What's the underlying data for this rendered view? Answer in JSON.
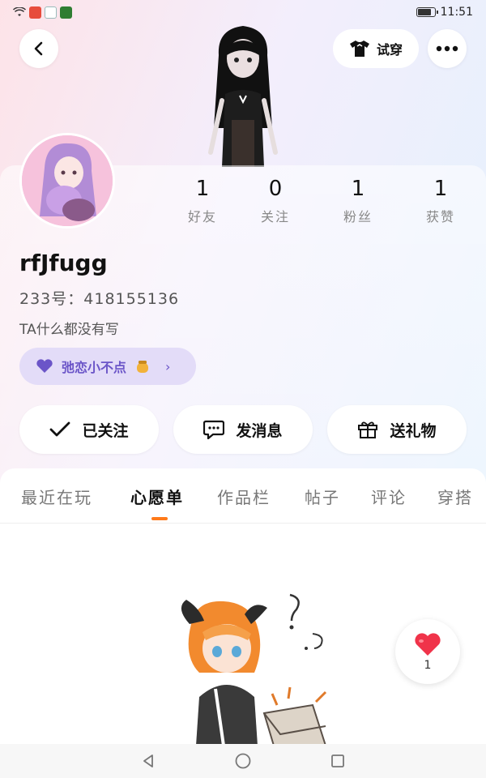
{
  "status_bar": {
    "time": "11:51"
  },
  "header": {
    "try_on_label": "试穿"
  },
  "stats": [
    {
      "value": "1",
      "label": "好友"
    },
    {
      "value": "0",
      "label": "关注"
    },
    {
      "value": "1",
      "label": "粉丝"
    },
    {
      "value": "1",
      "label": "获赞"
    }
  ],
  "profile": {
    "username": "rfJfugg",
    "uid": "233号：418155136",
    "bio": "TA什么都没有写",
    "fan_badge": "弛恋小不点"
  },
  "actions": {
    "follow_label": "已关注",
    "message_label": "发消息",
    "gift_label": "送礼物"
  },
  "tabs": [
    {
      "label": "最近在玩"
    },
    {
      "label": "心愿单"
    },
    {
      "label": "作品栏"
    },
    {
      "label": "帖子"
    },
    {
      "label": "评论"
    },
    {
      "label": "穿搭"
    }
  ],
  "active_tab": "心愿单",
  "like_fab": {
    "count": "1"
  },
  "colors": {
    "accent": "#ff7a1a",
    "badge_bg": "#e3dcf8",
    "badge_text": "#6b55c8",
    "heart": "#f0334a"
  }
}
